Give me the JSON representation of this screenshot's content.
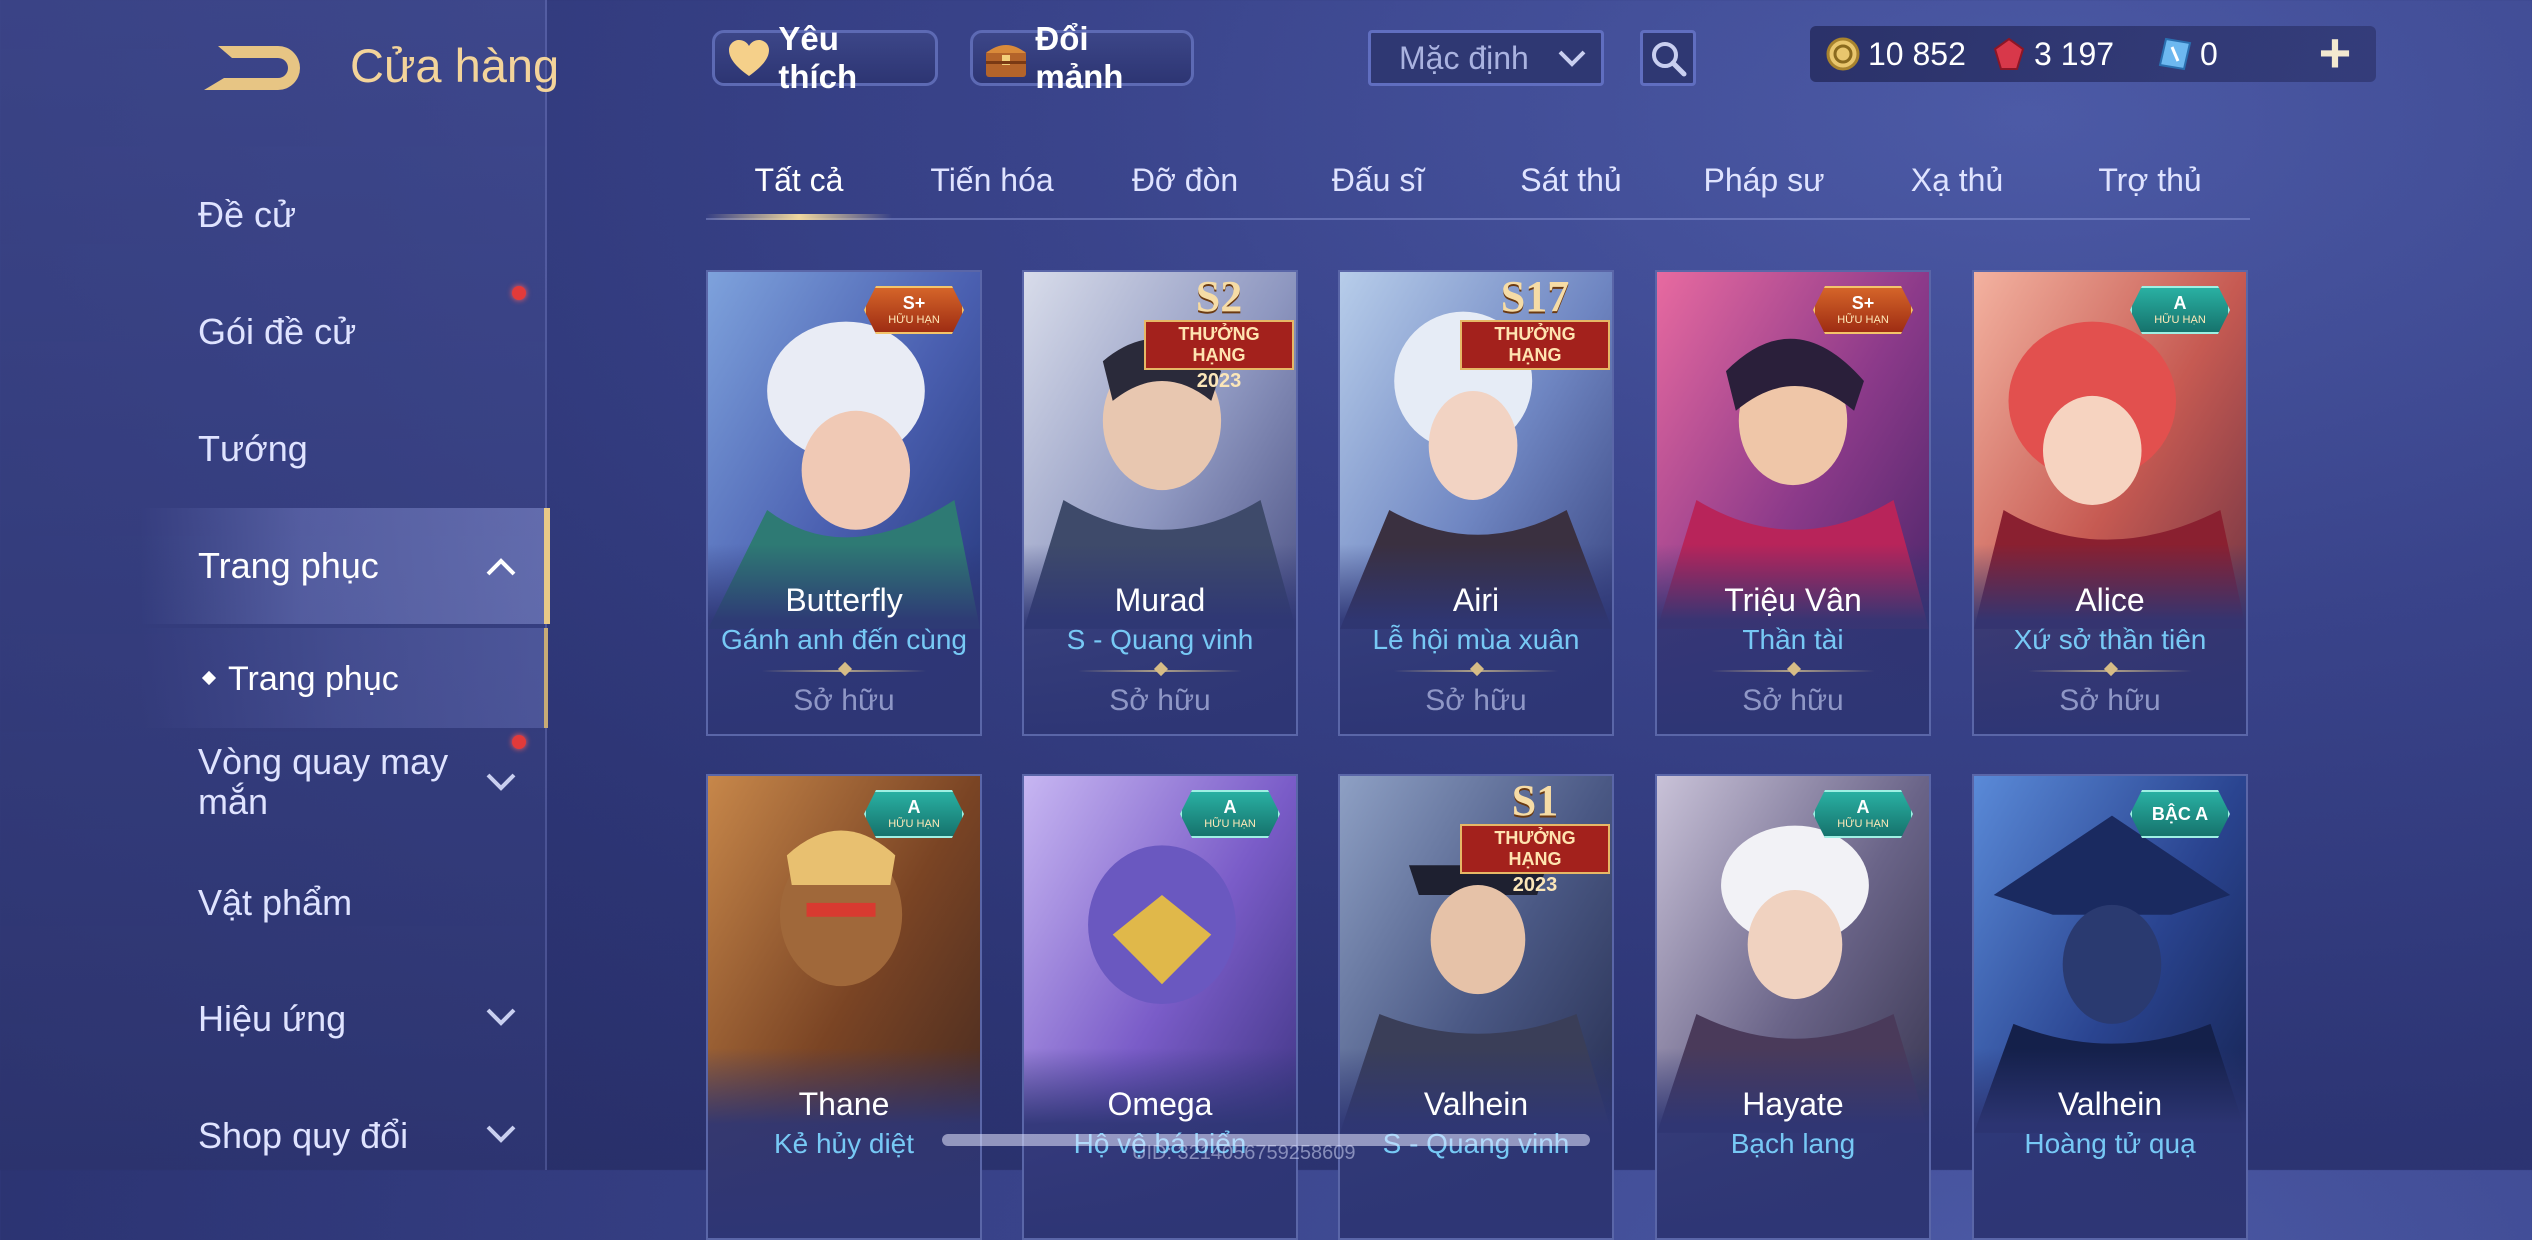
{
  "header": {
    "title": "Cửa hàng",
    "favorite_label": "Yêu thích",
    "shard_label": "Đổi mảnh",
    "sort_value": "Mặc định",
    "currencies": [
      {
        "icon": "gold-coin-icon",
        "value": "10 852"
      },
      {
        "icon": "ruby-icon",
        "value": "3 197"
      },
      {
        "icon": "voucher-icon",
        "value": "0"
      }
    ],
    "plus_label": "+"
  },
  "sidebar": {
    "items": [
      {
        "label": "Đề cử"
      },
      {
        "label": "Gói đề cử"
      },
      {
        "label": "Tướng"
      },
      {
        "label": "Trang phục"
      },
      {
        "label": "Trang phục"
      },
      {
        "label": "Vòng quay may mắn"
      },
      {
        "label": "Vật phẩm"
      },
      {
        "label": "Hiệu ứng"
      },
      {
        "label": "Shop quy đổi"
      }
    ]
  },
  "tabs": [
    {
      "label": "Tất cả"
    },
    {
      "label": "Tiến hóa"
    },
    {
      "label": "Đỡ đòn"
    },
    {
      "label": "Đấu sĩ"
    },
    {
      "label": "Sát thủ"
    },
    {
      "label": "Pháp sư"
    },
    {
      "label": "Xạ thủ"
    },
    {
      "label": "Trợ thủ"
    }
  ],
  "cards": [
    {
      "hero": "Butterfly",
      "skin": "Gánh anh đến cùng",
      "status": "Sở hữu",
      "badge": {
        "tier": "S+",
        "sub": "HỮU HẠN"
      }
    },
    {
      "hero": "Murad",
      "skin": "S - Quang vinh",
      "status": "Sở hữu",
      "badge": {
        "season": "S2",
        "label": "THƯỞNG HẠNG",
        "year": "2023"
      }
    },
    {
      "hero": "Airi",
      "skin": "Lễ hội mùa xuân",
      "status": "Sở hữu",
      "badge": {
        "season": "S17",
        "label": "THƯỞNG HẠNG"
      }
    },
    {
      "hero": "Triệu Vân",
      "skin": "Thần tài",
      "status": "Sở hữu",
      "badge": {
        "tier": "S+",
        "sub": "HỮU HẠN"
      }
    },
    {
      "hero": "Alice",
      "skin": "Xứ sở thần tiên",
      "status": "Sở hữu",
      "badge": {
        "tier": "A",
        "sub": "HỮU HẠN"
      }
    },
    {
      "hero": "Thane",
      "skin": "Kẻ hủy diệt",
      "badge": {
        "tier": "A",
        "sub": "HỮU HẠN"
      }
    },
    {
      "hero": "Omega",
      "skin": "Hộ vệ bá biển",
      "badge": {
        "tier": "A",
        "sub": "HỮU HẠN"
      }
    },
    {
      "hero": "Valhein",
      "skin": "S - Quang vinh",
      "badge": {
        "season": "S1",
        "label": "THƯỞNG HẠNG",
        "year": "2023"
      }
    },
    {
      "hero": "Hayate",
      "skin": "Bạch lang",
      "badge": {
        "tier": "A",
        "sub": "HỮU HẠN"
      }
    },
    {
      "hero": "Valhein",
      "skin": "Hoàng tử quạ",
      "badge": {
        "tier": "BẬC A"
      }
    }
  ],
  "footer": {
    "uid": "UID: 3214056759258609"
  },
  "colors": {
    "background": "#343c7e",
    "accent_gold": "#f3d49a",
    "skin_name_blue": "#77c9f5",
    "notification_red": "#e23a3a"
  }
}
